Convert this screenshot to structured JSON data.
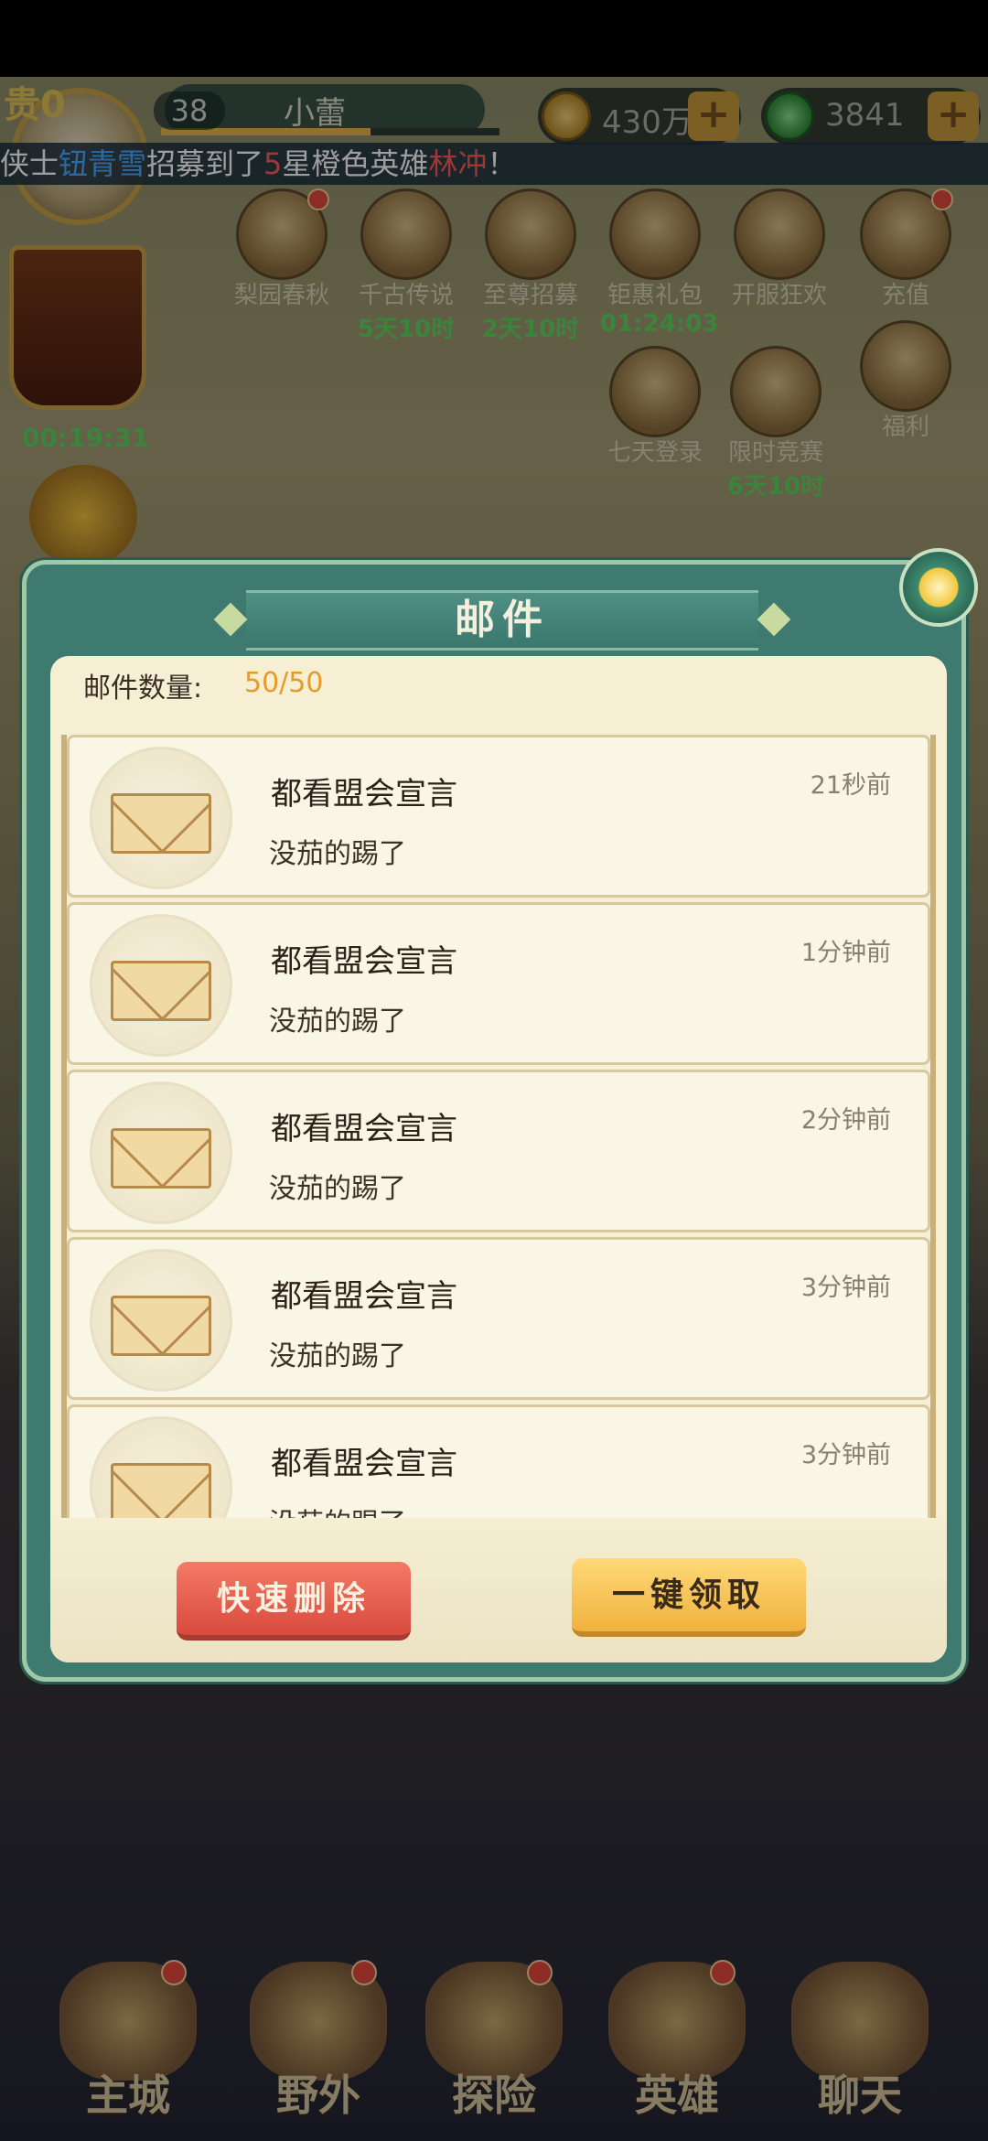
{
  "hud": {
    "noble": "贵0",
    "level": "38",
    "player_name": "小蕾",
    "exp_progress": 0.62,
    "coins": "430万",
    "jade": "3841",
    "plus": "+"
  },
  "ticker": {
    "prefix": "侠士",
    "player": "钮青雪",
    "mid1": "招募到了",
    "stars": "5",
    "mid2": "星橙色英雄",
    "hero": "林冲",
    "suffix": "！"
  },
  "activities": [
    {
      "label": "梨园春秋",
      "timer": ""
    },
    {
      "label": "千古传说",
      "timer": "5天10时"
    },
    {
      "label": "至尊招募",
      "timer": "2天10时"
    },
    {
      "label": "钜惠礼包",
      "timer": "01:24:03"
    },
    {
      "label": "开服狂欢",
      "timer": ""
    },
    {
      "label": "充值",
      "timer": ""
    },
    {
      "label": "七天登录",
      "timer": ""
    },
    {
      "label": "限时竞赛",
      "timer": "6天10时"
    },
    {
      "label": "福利",
      "timer": ""
    }
  ],
  "rank": {
    "timer": "00:19:31"
  },
  "dialog": {
    "title": "邮件",
    "count_label": "邮件数量:",
    "count_value": "50/50",
    "mails": [
      {
        "title": "都看盟会宣言",
        "subtitle": "没茄的踢了",
        "time": "21秒前"
      },
      {
        "title": "都看盟会宣言",
        "subtitle": "没茄的踢了",
        "time": "1分钟前"
      },
      {
        "title": "都看盟会宣言",
        "subtitle": "没茄的踢了",
        "time": "2分钟前"
      },
      {
        "title": "都看盟会宣言",
        "subtitle": "没茄的踢了",
        "time": "3分钟前"
      },
      {
        "title": "都看盟会宣言",
        "subtitle": "没茄的踢了",
        "time": "3分钟前"
      }
    ],
    "delete_label": "快速删除",
    "claim_label": "一键领取"
  },
  "nav": [
    {
      "label": "主城"
    },
    {
      "label": "野外"
    },
    {
      "label": "探险"
    },
    {
      "label": "英雄"
    },
    {
      "label": "聊天"
    }
  ],
  "colors": {
    "dialog_frame": "#3e7a70",
    "panel": "#f6efd3",
    "count_value": "#e69a2a",
    "delete_button": "#e45a4a",
    "claim_button": "#f6c24e",
    "timer_green": "#5fd65f"
  }
}
